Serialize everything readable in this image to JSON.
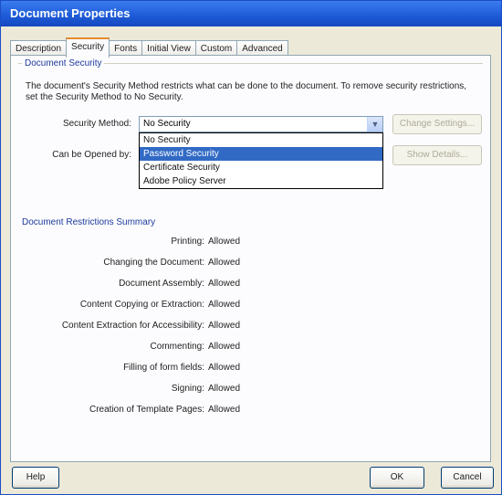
{
  "window": {
    "title": "Document Properties"
  },
  "tabs": [
    {
      "label": "Description",
      "active": false
    },
    {
      "label": "Security",
      "active": true
    },
    {
      "label": "Fonts",
      "active": false
    },
    {
      "label": "Initial View",
      "active": false
    },
    {
      "label": "Custom",
      "active": false
    },
    {
      "label": "Advanced",
      "active": false
    }
  ],
  "security": {
    "group_title": "Document Security",
    "description": "The document's Security Method restricts what can be done to the document. To remove security restrictions, set the Security Method to No Security.",
    "method_label": "Security Method:",
    "method_value": "No Security",
    "method_options": [
      "No Security",
      "Password Security",
      "Certificate Security",
      "Adobe Policy Server"
    ],
    "selected_option_index": 1,
    "can_be_opened_label": "Can be Opened by:",
    "change_settings_button": "Change Settings...",
    "show_details_button": "Show Details..."
  },
  "restrictions": {
    "header": "Document Restrictions Summary",
    "rows": [
      {
        "label": "Printing:",
        "value": "Allowed"
      },
      {
        "label": "Changing the Document:",
        "value": "Allowed"
      },
      {
        "label": "Document Assembly:",
        "value": "Allowed"
      },
      {
        "label": "Content Copying or Extraction:",
        "value": "Allowed"
      },
      {
        "label": "Content Extraction for Accessibility:",
        "value": "Allowed"
      },
      {
        "label": "Commenting:",
        "value": "Allowed"
      },
      {
        "label": "Filling of form fields:",
        "value": "Allowed"
      },
      {
        "label": "Signing:",
        "value": "Allowed"
      },
      {
        "label": "Creation of Template Pages:",
        "value": "Allowed"
      }
    ]
  },
  "footer": {
    "help_button": "Help",
    "ok_button": "OK",
    "cancel_button": "Cancel"
  }
}
